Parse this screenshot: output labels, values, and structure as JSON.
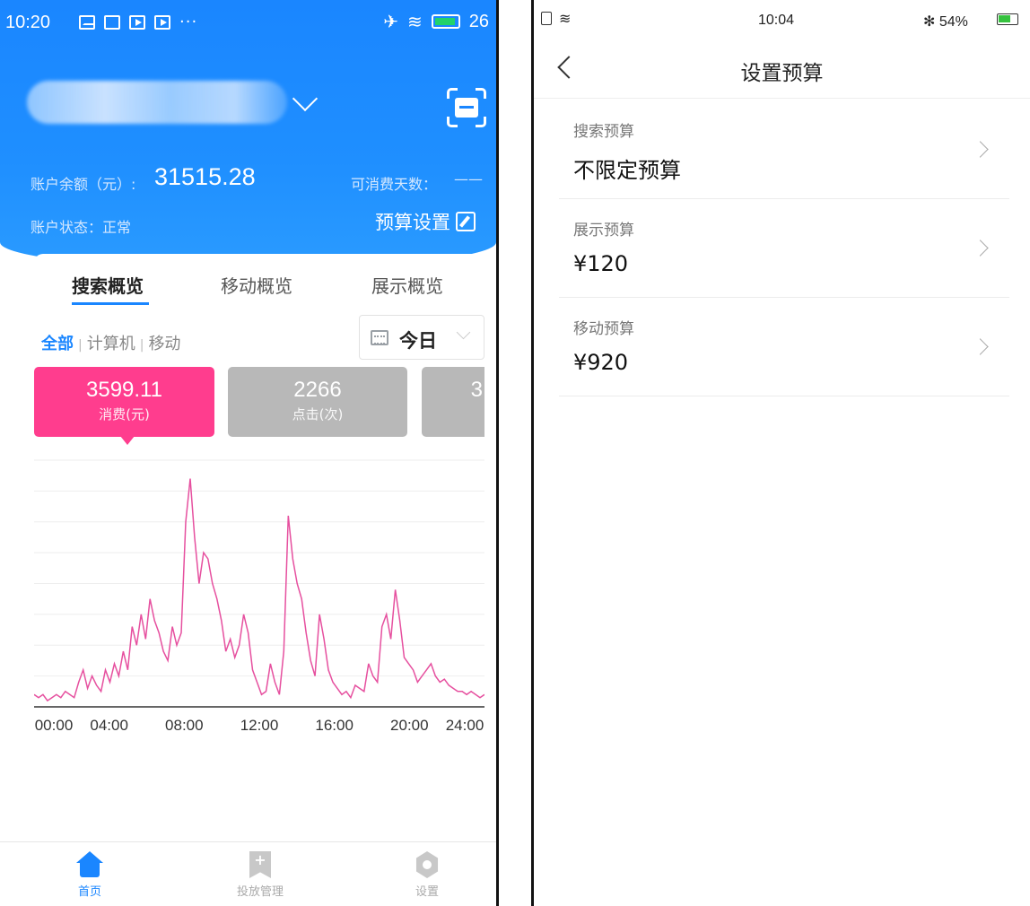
{
  "left": {
    "status_bar": {
      "time": "10:20",
      "battery": "26"
    },
    "header": {
      "balance_label": "账户余额（元）:",
      "balance_value": "31515.28",
      "days_label": "可消费天数：",
      "days_value": "——",
      "status_label": "账户状态：正常",
      "budget_button": "预算设置"
    },
    "tabs": [
      {
        "label": "搜索概览",
        "active": true
      },
      {
        "label": "移动概览",
        "active": false
      },
      {
        "label": "展示概览",
        "active": false
      }
    ],
    "filter": {
      "all": "全部",
      "computer": "计算机",
      "mobile": "移动"
    },
    "date_picker": {
      "selected": "今日"
    },
    "metrics": [
      {
        "value": "3599.11",
        "label": "消费(元)",
        "color": "#ff3d8e"
      },
      {
        "value": "2266",
        "label": "点击(次)",
        "color": "#b8b8b8"
      },
      {
        "value": "3",
        "label": "",
        "color": "#b8b8b8"
      }
    ],
    "chart_data": {
      "type": "line",
      "x_ticks": [
        "00:00",
        "04:00",
        "08:00",
        "12:00",
        "16:00",
        "20:00",
        "24:00"
      ],
      "line_color": "#e6509f",
      "grid": true,
      "series": [
        {
          "values": [
            4,
            3,
            4,
            2,
            3,
            4,
            3,
            5,
            4,
            3,
            8,
            12,
            6,
            10,
            7,
            5,
            12,
            8,
            14,
            10,
            18,
            12,
            26,
            20,
            30,
            22,
            35,
            28,
            24,
            18,
            15,
            26,
            20,
            24,
            60,
            74,
            55,
            40,
            50,
            48,
            40,
            35,
            28,
            18,
            22,
            16,
            20,
            30,
            24,
            12,
            8,
            4,
            5,
            14,
            8,
            4,
            18,
            62,
            48,
            40,
            35,
            24,
            15,
            10,
            30,
            22,
            12,
            8,
            6,
            4,
            5,
            3,
            7,
            6,
            5,
            14,
            10,
            8,
            26,
            30,
            22,
            38,
            28,
            16,
            14,
            12,
            8,
            10,
            12,
            14,
            10,
            8,
            9,
            7,
            6,
            5,
            5,
            4,
            5,
            4,
            3,
            4
          ]
        }
      ]
    },
    "bottom_nav": [
      {
        "label": "首页",
        "icon": "home-icon",
        "active": true
      },
      {
        "label": "投放管理",
        "icon": "bookmark-icon",
        "active": false
      },
      {
        "label": "设置",
        "icon": "gear-icon",
        "active": false
      }
    ]
  },
  "right": {
    "status_bar": {
      "time": "10:04",
      "bluetooth": "✻",
      "battery": "54%"
    },
    "title": "设置预算",
    "rows": [
      {
        "title": "搜索预算",
        "value": "不限定预算"
      },
      {
        "title": "展示预算",
        "value": "¥120"
      },
      {
        "title": "移动预算",
        "value": "¥920"
      }
    ]
  }
}
